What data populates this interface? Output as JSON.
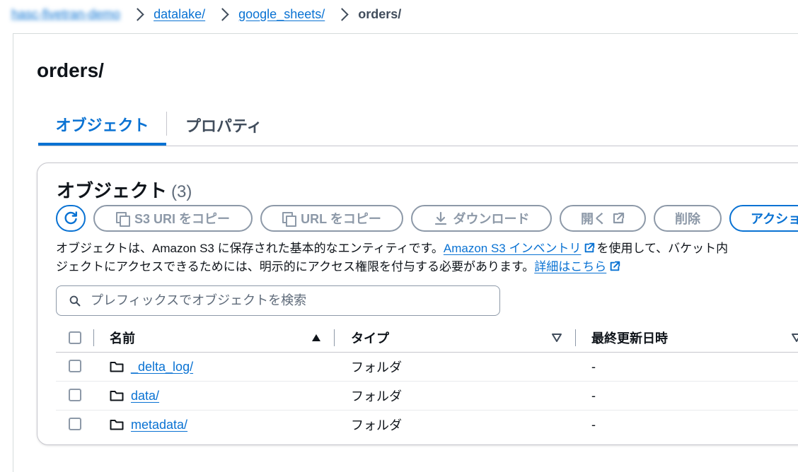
{
  "breadcrumb": {
    "items": [
      "hasc-fivetran-demo",
      "datalake/",
      "google_sheets/"
    ],
    "current": "orders/"
  },
  "page_title": "orders/",
  "tabs": [
    {
      "label": "オブジェクト",
      "active": true
    },
    {
      "label": "プロパティ",
      "active": false
    }
  ],
  "panel": {
    "title": "オブジェクト",
    "count": "(3)"
  },
  "toolbar": {
    "copy_s3_uri": "S3 URI をコピー",
    "copy_url": "URL をコピー",
    "download": "ダウンロード",
    "open": "開く",
    "delete": "削除",
    "actions": "アクショ"
  },
  "description": {
    "line1_before": "オブジェクトは、Amazon S3 に保存された基本的なエンティティです。",
    "inventory_link": "Amazon S3 インベントリ",
    "line1_after": "を使用して、バケット内",
    "line2_before": "ジェクトにアクセスできるためには、明示的にアクセス権限を付与する必要があります。",
    "learn_more_link": "詳細はこちら"
  },
  "search": {
    "placeholder": "プレフィックスでオブジェクトを検索"
  },
  "table": {
    "columns": {
      "name": "名前",
      "type": "タイプ",
      "last_modified": "最終更新日時"
    },
    "rows": [
      {
        "name": "_delta_log/",
        "type": "フォルダ",
        "last_modified": "-"
      },
      {
        "name": "data/",
        "type": "フォルダ",
        "last_modified": "-"
      },
      {
        "name": "metadata/",
        "type": "フォルダ",
        "last_modified": "-"
      }
    ]
  },
  "colors": {
    "link": "#0972d3",
    "text": "#0f141a",
    "disabled": "#8d99a8"
  }
}
